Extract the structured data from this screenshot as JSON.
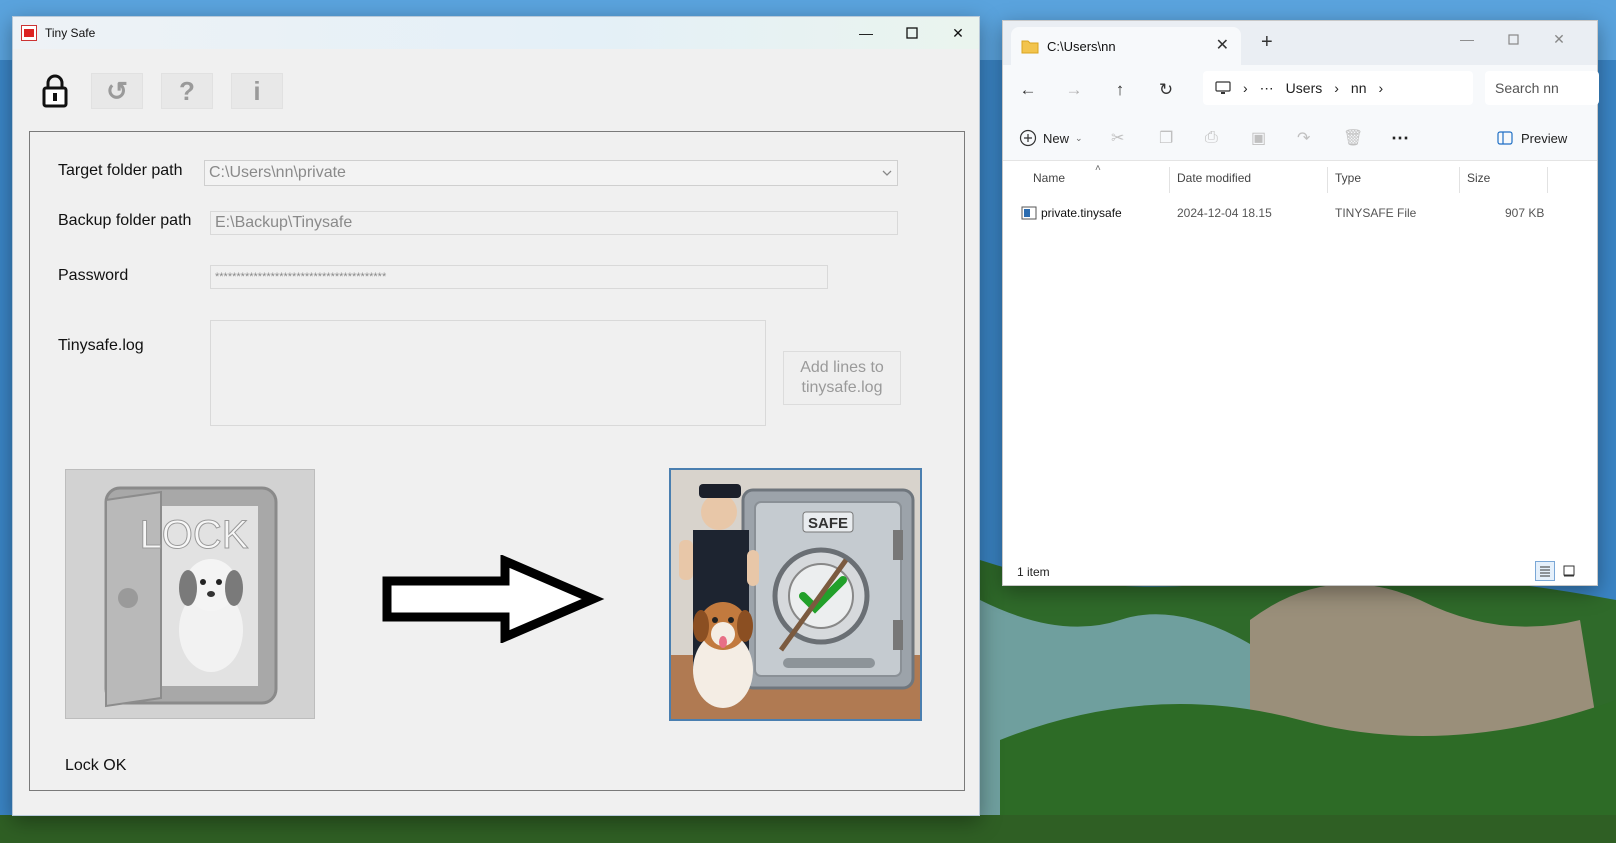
{
  "tinysafe": {
    "title": "Tiny Safe",
    "toolbar": {
      "refresh_icon": "↺",
      "help_icon": "?",
      "info_icon": "i"
    },
    "labels": {
      "target": "Target folder path",
      "backup": "Backup folder path",
      "password": "Password",
      "log": "Tinysafe.log"
    },
    "fields": {
      "target_value": "C:\\Users\\nn\\private",
      "backup_value": "E:\\Backup\\Tinysafe",
      "password_value": "****************************************"
    },
    "add_lines_button": "Add lines to tinysafe.log",
    "lock_image_text": "LOCK",
    "safe_image_text": "SAFE",
    "status": "Lock OK"
  },
  "explorer": {
    "tab_title": "C:\\Users\\nn",
    "breadcrumb": [
      "Users",
      "nn"
    ],
    "search_placeholder": "Search nn",
    "new_label": "New",
    "preview_label": "Preview",
    "columns": [
      "Name",
      "Date modified",
      "Type",
      "Size"
    ],
    "rows": [
      {
        "name": "private.tinysafe",
        "date": "2024-12-04 18.15",
        "type": "TINYSAFE File",
        "size": "907 KB"
      }
    ],
    "status": "1 item"
  },
  "colors": {
    "accent": "#4a7fb0",
    "panel_bg": "#f0f0f0",
    "check_green": "#22a02a"
  }
}
